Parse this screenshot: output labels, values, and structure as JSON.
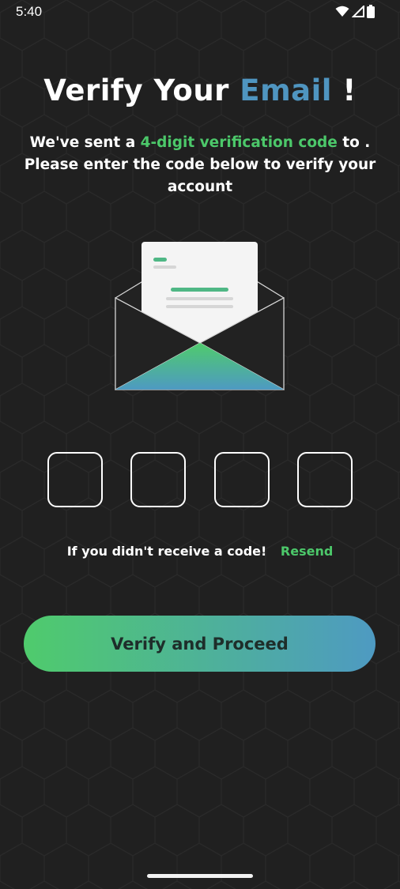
{
  "status_bar": {
    "time": "5:40",
    "icons": [
      "wifi-icon",
      "signal-icon",
      "battery-icon"
    ]
  },
  "header": {
    "title_prefix": "Verify Your ",
    "title_accent": "Email",
    "title_suffix": " !"
  },
  "message": {
    "part1": "We've sent a ",
    "highlight": "4-digit verification code",
    "part2": " to . Please enter the code below to verify your account"
  },
  "otp": {
    "digits": [
      "",
      "",
      "",
      ""
    ]
  },
  "resend": {
    "prompt": "If you didn't receive a code!",
    "link_label": "Resend"
  },
  "actions": {
    "verify_label": "Verify and Proceed"
  },
  "colors": {
    "background": "#202020",
    "accent_blue": "#4f95c0",
    "accent_green": "#4cc86a",
    "button_gradient_start": "#4fcb6c",
    "button_gradient_end": "#4e9ac2"
  }
}
